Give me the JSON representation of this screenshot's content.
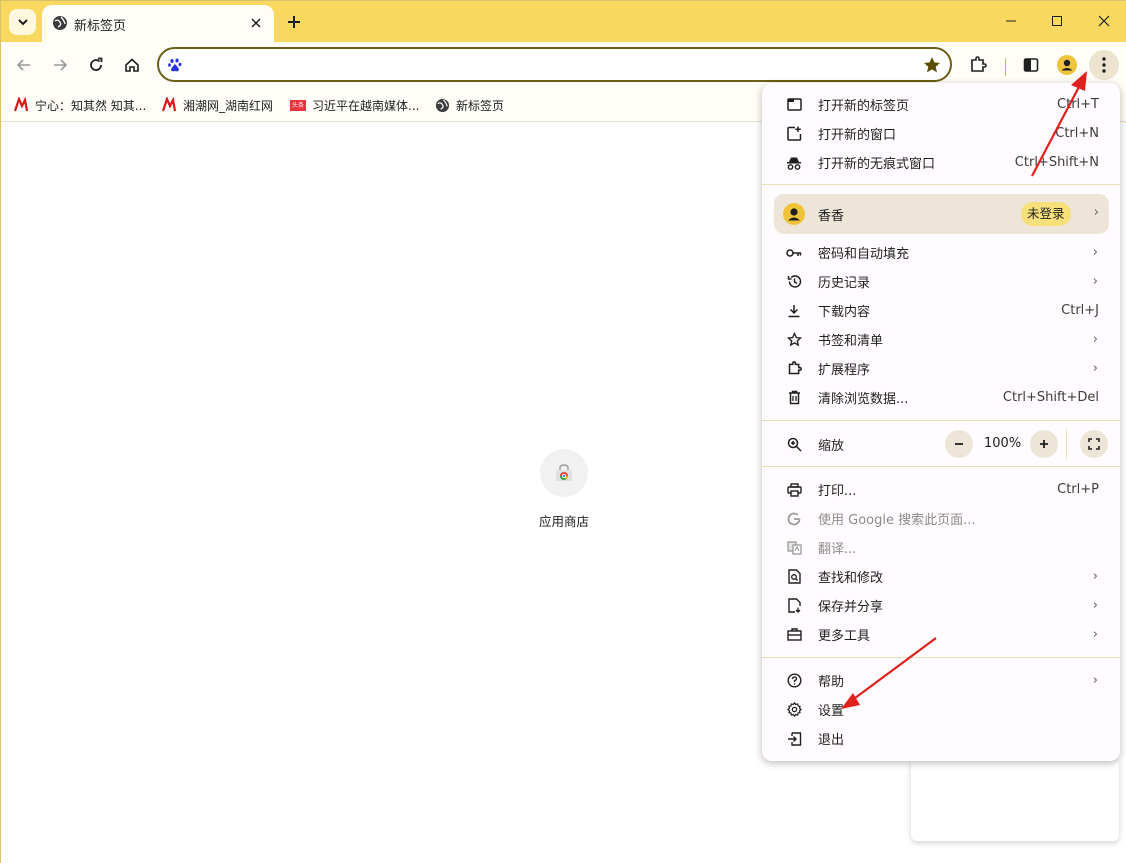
{
  "tab": {
    "title": "新标签页"
  },
  "bookmarks": [
    {
      "label": "宁心：知其然 知其..."
    },
    {
      "label": "湘潮网_湖南红网"
    },
    {
      "label": "习近平在越南媒体..."
    },
    {
      "label": "新标签页"
    }
  ],
  "bookmark_badge": "头条",
  "content": {
    "shortcut_label": "应用商店"
  },
  "menu": {
    "new_tab": {
      "label": "打开新的标签页",
      "shortcut": "Ctrl+T"
    },
    "new_window": {
      "label": "打开新的窗口",
      "shortcut": "Ctrl+N"
    },
    "incognito": {
      "label": "打开新的无痕式窗口",
      "shortcut": "Ctrl+Shift+N"
    },
    "profile": {
      "name": "香香",
      "status": "未登录"
    },
    "passwords": {
      "label": "密码和自动填充"
    },
    "history": {
      "label": "历史记录"
    },
    "downloads": {
      "label": "下载内容",
      "shortcut": "Ctrl+J"
    },
    "bookmarks": {
      "label": "书签和清单"
    },
    "extensions": {
      "label": "扩展程序"
    },
    "clear_data": {
      "label": "清除浏览数据...",
      "shortcut": "Ctrl+Shift+Del"
    },
    "zoom": {
      "label": "缩放",
      "value": "100%"
    },
    "print": {
      "label": "打印...",
      "shortcut": "Ctrl+P"
    },
    "search_google": {
      "label": "使用 Google 搜索此页面..."
    },
    "translate": {
      "label": "翻译..."
    },
    "find_edit": {
      "label": "查找和修改"
    },
    "save_share": {
      "label": "保存并分享"
    },
    "more_tools": {
      "label": "更多工具"
    },
    "help": {
      "label": "帮助"
    },
    "settings": {
      "label": "设置"
    },
    "exit": {
      "label": "退出"
    }
  },
  "colors": {
    "titlebar": "#f8d85e",
    "menu_bg": "#fffbff",
    "annotation_arrow": "#e0201c"
  }
}
